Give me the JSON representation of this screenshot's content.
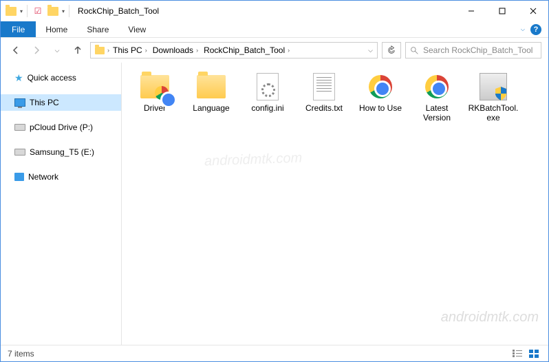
{
  "title": "RockChip_Batch_Tool",
  "ribbon": {
    "file": "File",
    "home": "Home",
    "share": "Share",
    "view": "View"
  },
  "breadcrumb": [
    "This PC",
    "Downloads",
    "RockChip_Batch_Tool"
  ],
  "search": {
    "placeholder": "Search RockChip_Batch_Tool"
  },
  "sidebar": {
    "quick_access": "Quick access",
    "this_pc": "This PC",
    "pcloud": "pCloud Drive (P:)",
    "samsung": "Samsung_T5 (E:)",
    "network": "Network"
  },
  "items": [
    {
      "label": "Driver",
      "type": "folder-chrome"
    },
    {
      "label": "Language",
      "type": "folder"
    },
    {
      "label": "config.ini",
      "type": "ini"
    },
    {
      "label": "Credits.txt",
      "type": "txt"
    },
    {
      "label": "How to Use",
      "type": "chrome"
    },
    {
      "label": "Latest Version",
      "type": "chrome"
    },
    {
      "label": "RKBatchTool.exe",
      "type": "exe"
    }
  ],
  "status": {
    "count": "7 items"
  },
  "watermark": "androidmtk.com"
}
